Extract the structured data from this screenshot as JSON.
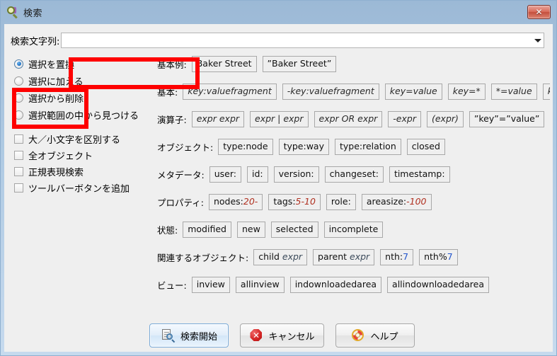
{
  "window": {
    "title": "検索",
    "title_icon": "magnifier-icon",
    "close_label": "✕"
  },
  "search": {
    "label": "検索文字列:",
    "value": "",
    "placeholder": "",
    "dropdown_icon": "chevron-down-icon"
  },
  "options": {
    "radios": [
      {
        "label": "選択を置換",
        "selected": true
      },
      {
        "label": "選択に加える",
        "selected": false
      },
      {
        "label": "選択から削除",
        "selected": false
      },
      {
        "label": "選択範囲の中から見つける",
        "selected": false
      }
    ],
    "checkboxes": [
      {
        "label": "大／小文字を区別する",
        "checked": false
      },
      {
        "label": "全オブジェクト",
        "checked": false
      },
      {
        "label": "正規表現検索",
        "checked": false
      },
      {
        "label": "ツールバーボタンを追加",
        "checked": false
      }
    ]
  },
  "examples": [
    {
      "label": "基本例:",
      "chips": [
        {
          "text": "Baker Street"
        },
        {
          "text": "”Baker Street”"
        }
      ]
    },
    {
      "label": "基本:",
      "chips": [
        {
          "text": "key:valuefragment",
          "style": "italic"
        },
        {
          "text": "-key:valuefragment",
          "style": "italic"
        },
        {
          "text": "key=value",
          "style": "italic"
        },
        {
          "text": "key=*",
          "style": "italic"
        },
        {
          "text": "*=value",
          "style": "italic"
        },
        {
          "text": "key=",
          "style": "italic"
        }
      ]
    },
    {
      "label": "演算子:",
      "chips": [
        {
          "text": "expr expr",
          "style": "italic"
        },
        {
          "text": "expr | expr",
          "style": "italic"
        },
        {
          "text": "expr OR expr",
          "style": "italic"
        },
        {
          "text": "-expr",
          "style": "italic"
        },
        {
          "text": "(expr)",
          "style": "italic"
        },
        {
          "text": "”key”=”value”"
        }
      ]
    },
    {
      "label": "オブジェクト:",
      "chips": [
        {
          "text": "type:node"
        },
        {
          "text": "type:way"
        },
        {
          "text": "type:relation"
        },
        {
          "text": "closed"
        }
      ]
    },
    {
      "label": "メタデータ:",
      "chips": [
        {
          "text": "user:"
        },
        {
          "text": "id:"
        },
        {
          "text": "version:"
        },
        {
          "text": "changeset:"
        },
        {
          "text": "timestamp:"
        }
      ]
    },
    {
      "label": "プロパティ:",
      "chips": [
        {
          "text": "nodes:20-"
        },
        {
          "text": "tags:5-10"
        },
        {
          "text": "role:"
        },
        {
          "text": "areasize:-100"
        }
      ]
    },
    {
      "label": "状態:",
      "chips": [
        {
          "text": "modified"
        },
        {
          "text": "new"
        },
        {
          "text": "selected"
        },
        {
          "text": "incomplete"
        }
      ]
    },
    {
      "label": "関連するオブジェクト:",
      "chips": [
        {
          "text": "child expr"
        },
        {
          "text": "parent expr"
        },
        {
          "text": "nth:7"
        },
        {
          "text": "nth%7"
        }
      ]
    },
    {
      "label": "ビュー:",
      "chips": [
        {
          "text": "inview"
        },
        {
          "text": "allinview"
        },
        {
          "text": "indownloadedarea"
        },
        {
          "text": "allindownloadedarea"
        }
      ]
    }
  ],
  "buttons": [
    {
      "label": "検索開始",
      "icon": "search-document-icon",
      "default": true
    },
    {
      "label": "キャンセル",
      "icon": "cancel-octagon-icon",
      "default": false
    },
    {
      "label": "ヘルプ",
      "icon": "lifebuoy-icon",
      "default": false
    }
  ],
  "annotations": {
    "color": "#fe0000",
    "boxes": [
      {
        "name": "search-field-highlight"
      },
      {
        "name": "selection-mode-highlight"
      }
    ]
  }
}
